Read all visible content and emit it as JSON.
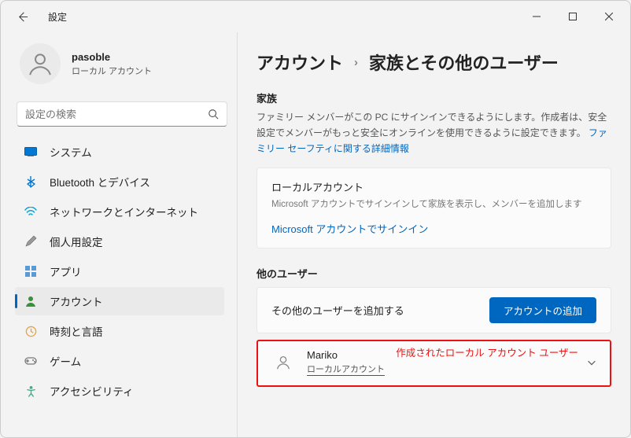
{
  "window": {
    "title": "設定"
  },
  "profile": {
    "name": "pasoble",
    "sub": "ローカル アカウント"
  },
  "search": {
    "placeholder": "設定の検索"
  },
  "nav": {
    "items": [
      {
        "label": "システム"
      },
      {
        "label": "Bluetooth とデバイス"
      },
      {
        "label": "ネットワークとインターネット"
      },
      {
        "label": "個人用設定"
      },
      {
        "label": "アプリ"
      },
      {
        "label": "アカウント"
      },
      {
        "label": "時刻と言語"
      },
      {
        "label": "ゲーム"
      },
      {
        "label": "アクセシビリティ"
      }
    ]
  },
  "breadcrumb": {
    "root": "アカウント",
    "leaf": "家族とその他のユーザー"
  },
  "family": {
    "heading": "家族",
    "desc_a": "ファミリー メンバーがこの PC にサインインできるようにします。作成者は、安全設定でメンバーがもっと安全にオンラインを使用できるように設定できます。 ",
    "link": "ファミリー セーフティに関する詳細情報"
  },
  "local_card": {
    "title": "ローカルアカウント",
    "sub": "Microsoft アカウントでサインインして家族を表示し、メンバーを追加します",
    "link": "Microsoft アカウントでサインイン"
  },
  "others": {
    "heading": "他のユーザー",
    "add_text": "その他のユーザーを追加する",
    "add_button": "アカウントの追加"
  },
  "user": {
    "name": "Mariko",
    "type": "ローカルアカウント",
    "annotation": "作成されたローカル アカウント ユーザー"
  }
}
